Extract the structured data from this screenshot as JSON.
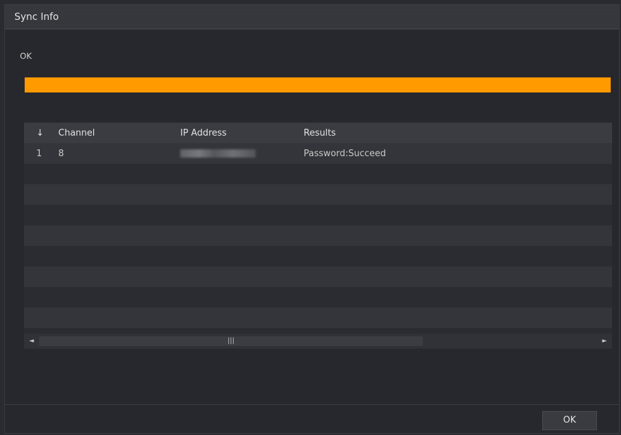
{
  "dialog": {
    "title": "Sync Info",
    "status": "OK",
    "progress_percent": 100,
    "progress_color": "#ff9a00"
  },
  "table": {
    "columns": [
      "↓",
      "Channel",
      "IP Address",
      "Results"
    ],
    "rows": [
      {
        "num": "1",
        "channel": "8",
        "ip": "",
        "result": "Password:Succeed"
      }
    ],
    "empty_row_count": 8
  },
  "scrollbar": {
    "left_arrow": "◄",
    "right_arrow": "►",
    "thumb_grip": "|||"
  },
  "footer": {
    "ok_label": "OK"
  }
}
